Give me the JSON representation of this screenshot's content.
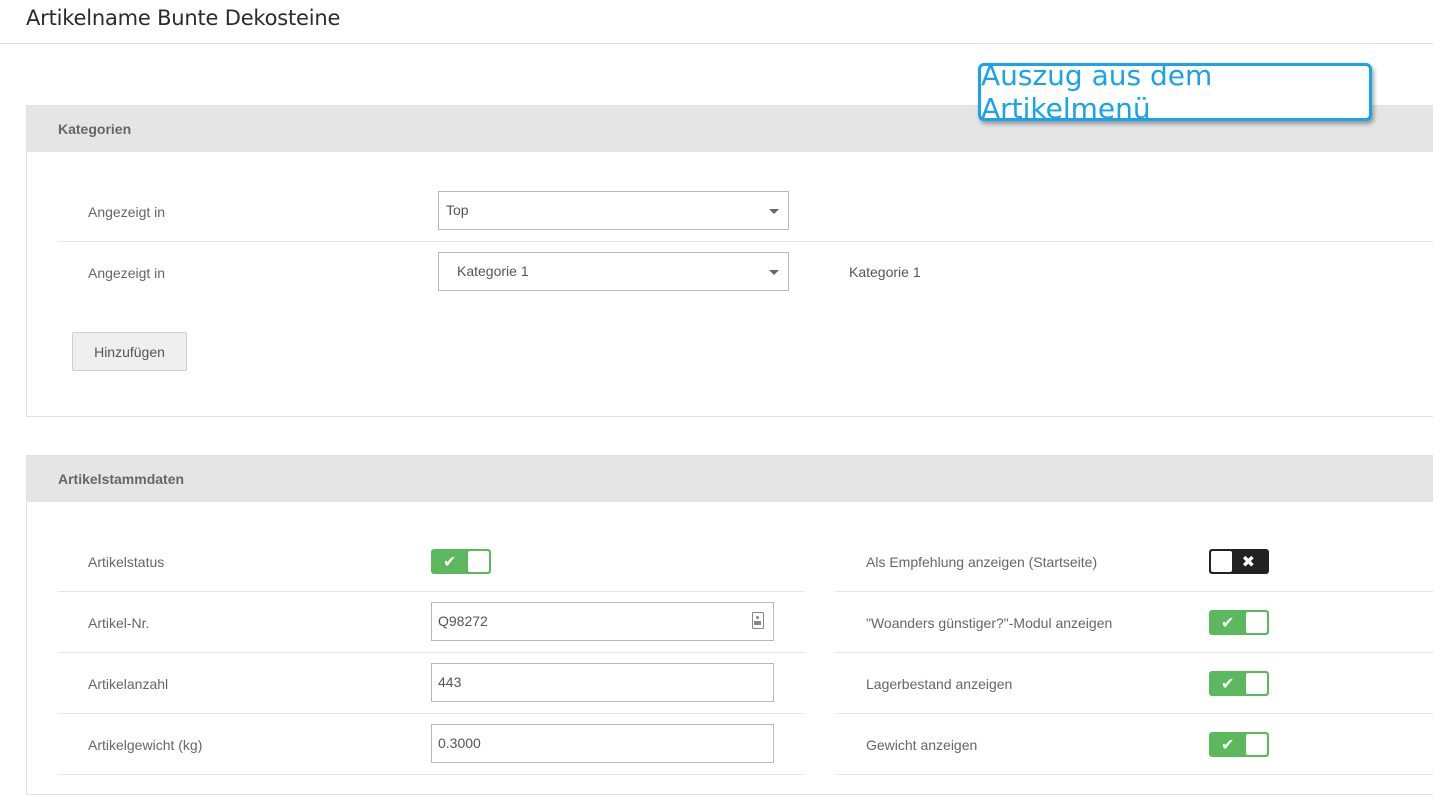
{
  "page": {
    "title": "Artikelname Bunte Dekosteine"
  },
  "callout": {
    "text": "Auszug aus dem Artikelmenü"
  },
  "categories": {
    "heading": "Kategorien",
    "rows": [
      {
        "label": "Angezeigt in",
        "selected": "Top"
      },
      {
        "label": "Angezeigt in",
        "selected": "Kategorie 1",
        "assigned": "Kategorie 1"
      }
    ],
    "add_button": "Hinzufügen"
  },
  "master_data": {
    "heading": "Artikelstammdaten",
    "left_rows": [
      {
        "label": "Artikelstatus",
        "toggle": "on"
      },
      {
        "label": "Artikel-Nr.",
        "value": "Q98272",
        "icon": "id-card-icon"
      },
      {
        "label": "Artikelanzahl",
        "value": "443"
      },
      {
        "label": "Artikelgewicht (kg)",
        "value": "0.3000"
      }
    ],
    "right_rows": [
      {
        "label": "Als Empfehlung anzeigen (Startseite)",
        "toggle": "off"
      },
      {
        "label": "\"Woanders günstiger?\"-Modul anzeigen",
        "toggle": "on"
      },
      {
        "label": "Lagerbestand anzeigen",
        "toggle": "on"
      },
      {
        "label": "Gewicht anzeigen",
        "toggle": "on"
      }
    ],
    "toggle_on_mark": "✔",
    "toggle_off_mark": "✖"
  },
  "colors": {
    "toggle_on": "#5cb85c",
    "toggle_off": "#222222",
    "callout": "#1aa3e8",
    "panel_header": "#e5e5e5"
  }
}
